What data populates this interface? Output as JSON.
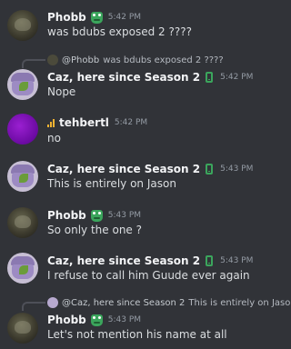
{
  "messages": [
    {
      "author": "Phobb",
      "time": "5:42 PM",
      "text": "was bdubs exposed 2 ????"
    },
    {
      "reply": {
        "author": "@Phobb",
        "text": "was bdubs exposed 2 ????"
      },
      "author": "Caz, here since Season 2",
      "time": "5:42 PM",
      "text": "Nope"
    },
    {
      "author": "tehbertl",
      "time": "5:42 PM",
      "text": "no"
    },
    {
      "author": "Caz, here since Season 2",
      "time": "5:43 PM",
      "text": "This is entirely on Jason"
    },
    {
      "author": "Phobb",
      "time": "5:43 PM",
      "text": "So only the one ?"
    },
    {
      "author": "Caz, here since Season 2",
      "time": "5:43 PM",
      "text": "I refuse to call him Guude ever again"
    },
    {
      "reply": {
        "author": "@Caz, here since Season 2",
        "text": "This is entirely on Jason"
      },
      "author": "Phobb",
      "time": "5:43 PM",
      "text": "Let's not mention his name at all"
    }
  ]
}
